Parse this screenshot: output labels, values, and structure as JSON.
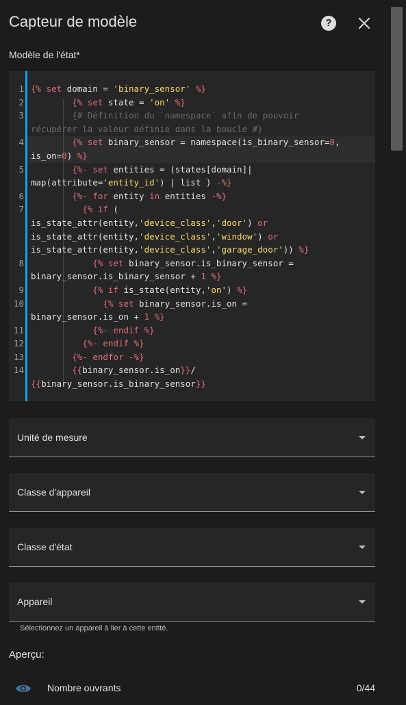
{
  "dialog": {
    "title": "Capteur de modèle",
    "help_icon": "help-circle-icon",
    "close_icon": "close-icon"
  },
  "state_template": {
    "label": "Modèle de l'état*",
    "line_numbers": [
      "1",
      "2",
      "3",
      "",
      "4",
      "",
      "5",
      "",
      "6",
      "7",
      "",
      "",
      "",
      "8",
      "",
      "9",
      "10",
      "",
      "11",
      "12",
      "13",
      "14",
      ""
    ]
  },
  "fields": {
    "unit": "Unité de mesure",
    "device_class": "Classe d'appareil",
    "state_class": "Classe d'état",
    "device": "Appareil",
    "device_helper": "Sélectionnez un appareil à lier à cette entité."
  },
  "preview": {
    "title": "Aperçu:",
    "icon": "eye-icon",
    "entity_name": "Nombre ouvrants",
    "state": "0/44"
  },
  "colors": {
    "accent": "#03a9f4",
    "keyword": "#e06c75",
    "string": "#ffd866",
    "background": "#1c1c1c"
  }
}
